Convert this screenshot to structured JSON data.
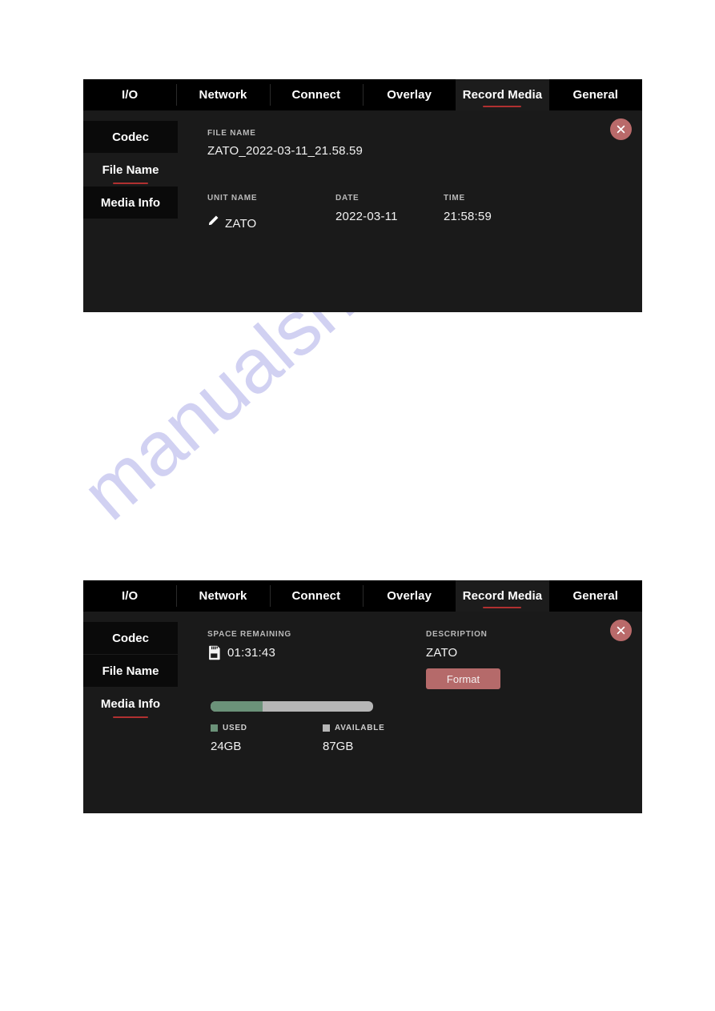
{
  "watermark": {
    "text": "manualshive.com"
  },
  "tabs": [
    {
      "label": "I/O",
      "active": false
    },
    {
      "label": "Network",
      "active": false
    },
    {
      "label": "Connect",
      "active": false
    },
    {
      "label": "Overlay",
      "active": false
    },
    {
      "label": "Record Media",
      "active": true
    },
    {
      "label": "General",
      "active": false
    }
  ],
  "sidebar": {
    "items": [
      "Codec",
      "File Name",
      "Media Info"
    ],
    "panel_one_selected": "File Name",
    "panel_two_selected": "Media Info"
  },
  "panel_one": {
    "file_name": {
      "label": "FILE NAME",
      "value": "ZATO_2022-03-11_21.58.59"
    },
    "unit_name": {
      "label": "UNIT NAME",
      "value": "ZATO",
      "icon": "pencil-icon"
    },
    "date": {
      "label": "DATE",
      "value": "2022-03-11"
    },
    "time": {
      "label": "TIME",
      "value": "21:58:59"
    },
    "close_label": "close-icon"
  },
  "panel_two": {
    "space_remaining": {
      "label": "SPACE REMAINING",
      "value": "01:31:43",
      "icon": "sd-card-icon"
    },
    "description": {
      "label": "DESCRIPTION",
      "value": "ZATO"
    },
    "format_button": "Format",
    "storage": {
      "used_label": "USED",
      "used_value": "24GB",
      "available_label": "AVAILABLE",
      "available_value": "87GB",
      "used_percent": 32,
      "used_color": "#6b9279",
      "available_color": "#b6b6b6"
    },
    "close_label": "close-icon"
  },
  "colors": {
    "accent_underline": "#b03030",
    "close_button": "#b96a6a",
    "format_button": "#b56a6a",
    "tab_bar_bg": "#000000",
    "panel_bg": "#1a1a1a"
  }
}
